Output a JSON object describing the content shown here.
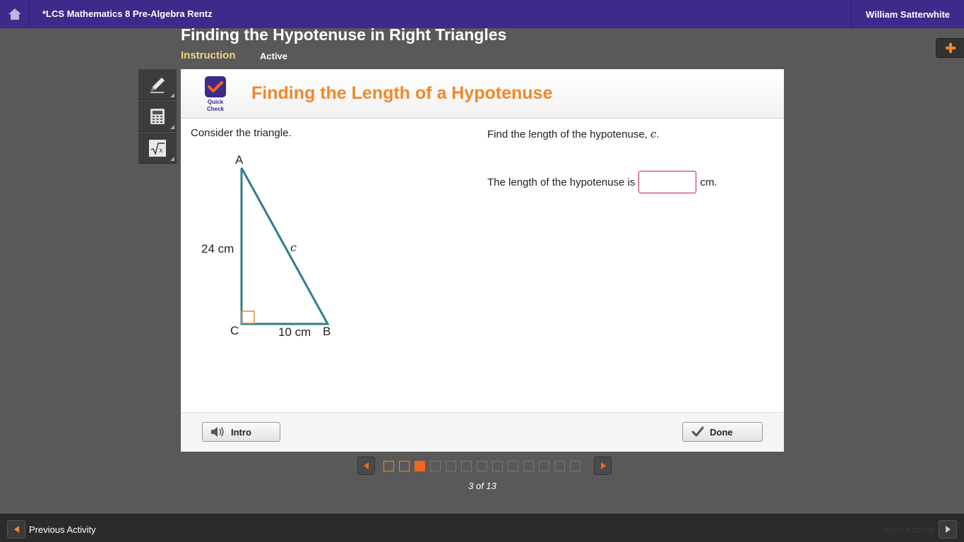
{
  "topbar": {
    "course_title": "*LCS Mathematics 8 Pre-Algebra Rentz",
    "user_name": "William Satterwhite"
  },
  "lesson": {
    "title": "Finding the Hypotenuse in Right Triangles",
    "mode": "Instruction",
    "status": "Active"
  },
  "tools": [
    {
      "icon": "pencil-icon"
    },
    {
      "icon": "calculator-icon"
    },
    {
      "icon": "square-root-icon"
    }
  ],
  "card": {
    "logo_line1": "Quick",
    "logo_line2": "Check",
    "title": "Finding the Length of a Hypotenuse",
    "left_prompt": "Consider the triangle.",
    "right_prompt": "Find the length of the hypotenuse,",
    "right_prompt_var": "c",
    "right_prompt_end": ".",
    "answer_prefix": "The length of the hypotenuse is",
    "answer_value": "",
    "answer_suffix": "cm.",
    "triangle": {
      "vertex_a": "A",
      "vertex_b": "B",
      "vertex_c": "C",
      "side_ac": "24 cm",
      "side_cb": "10 cm",
      "side_ab": "c"
    },
    "intro_label": "Intro",
    "done_label": "Done"
  },
  "pager": {
    "total": 13,
    "current": 3,
    "count_text": "3 of 13"
  },
  "bottombar": {
    "prev_label": "Previous Activity",
    "next_label": "Next Activity"
  },
  "colors": {
    "topbar": "#3d2a8a",
    "accent_orange": "#f0882a",
    "triangle_stroke": "#2e7d8a",
    "answer_border": "#c2185b"
  }
}
